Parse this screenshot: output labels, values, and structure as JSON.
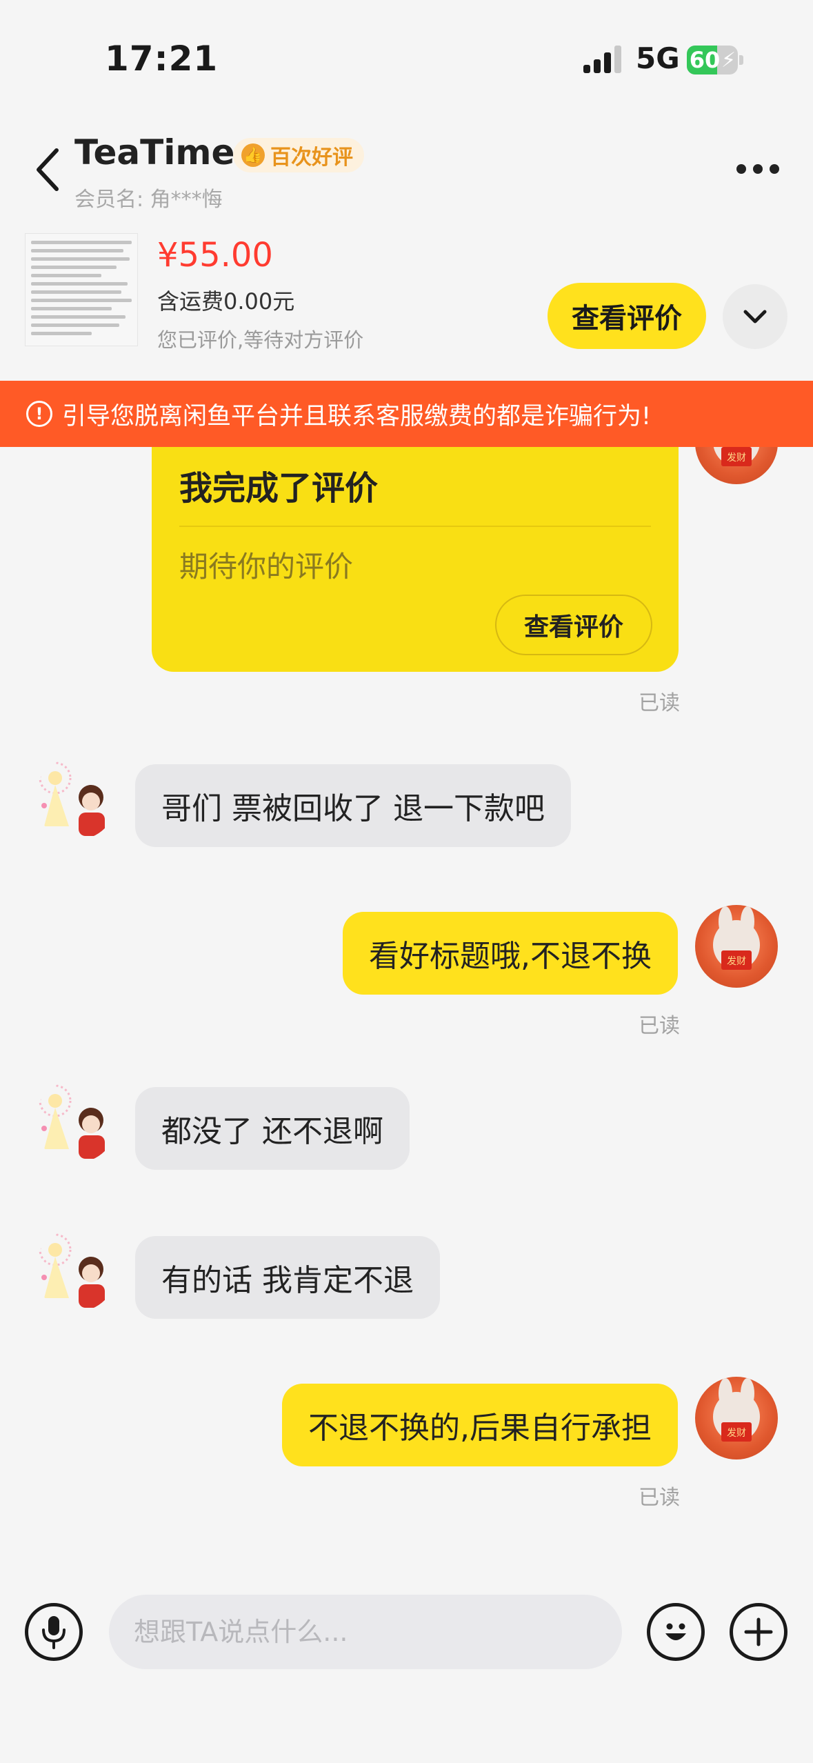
{
  "status_bar": {
    "time": "17:21",
    "network": "5G",
    "battery": "60",
    "battery_level": 0.6
  },
  "header": {
    "seller_name": "TeaTime",
    "badge": "百次好评",
    "member_label": "会员名:",
    "member_name": "角***悔"
  },
  "product": {
    "price": "¥55.00",
    "shipping": "含运费0.00元",
    "status": "您已评价,等待对方评价",
    "review_button": "查看评价"
  },
  "warning": {
    "text": "引导您脱离闲鱼平台并且联系客服缴费的都是诈骗行为!"
  },
  "review_card": {
    "title": "我完成了评价",
    "subtitle": "期待你的评价",
    "button": "查看评价",
    "read": "已读"
  },
  "messages": [
    {
      "from": "other",
      "text": "哥们 票被回收了 退一下款吧"
    },
    {
      "from": "self",
      "text": "看好标题哦,不退不换",
      "read": "已读"
    },
    {
      "from": "other",
      "text": "都没了 还不退啊"
    },
    {
      "from": "other",
      "text": "有的话 我肯定不退"
    },
    {
      "from": "self",
      "text": "不退不换的,后果自行承担",
      "read": "已读"
    }
  ],
  "input_bar": {
    "placeholder": "想跟TA说点什么..."
  },
  "avatar_caption": "发财",
  "colors": {
    "accent_yellow": "#ffe11d",
    "warning_orange": "#ff5a26",
    "price_red": "#ff3b30"
  }
}
